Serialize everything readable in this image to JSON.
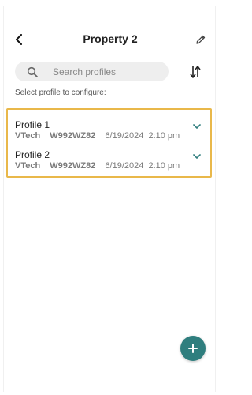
{
  "header": {
    "title": "Property 2",
    "back_icon": "chevron-left-icon",
    "edit_icon": "pencil-icon"
  },
  "search": {
    "placeholder": "Search profiles",
    "value": ""
  },
  "sort_icon": "sort-arrows-icon",
  "hint": "Select profile to configure:",
  "profiles": [
    {
      "name": "Profile 1",
      "brand": "VTech",
      "model": "W992WZ82",
      "timestamp": "6/19/2024  2:10 pm"
    },
    {
      "name": "Profile 2",
      "brand": "VTech",
      "model": "W992WZ82",
      "timestamp": "6/19/2024  2:10 pm"
    }
  ],
  "fab_icon": "plus-icon",
  "colors": {
    "accent": "#2f7e7e",
    "selection_border": "#e9b84a",
    "search_bg": "#eeeeee"
  }
}
